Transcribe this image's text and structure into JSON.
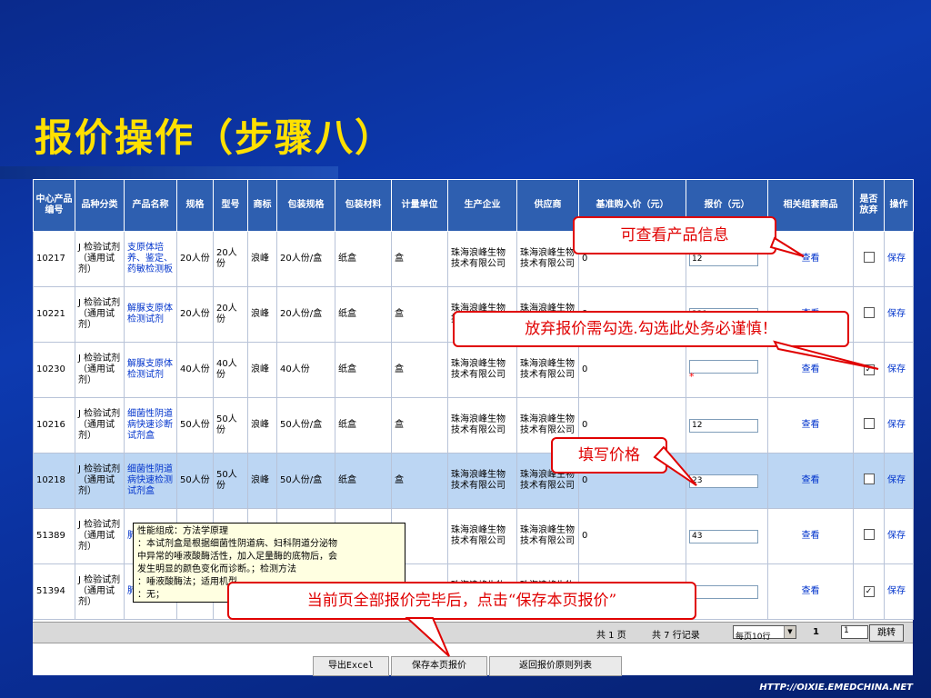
{
  "slide": {
    "title": "报价操作（步骤八）",
    "footer_url": "HTTP://OIXIE.EMEDCHINA.NET"
  },
  "table": {
    "headers": [
      "中心产品编号",
      "品种分类",
      "产品名称",
      "规格",
      "型号",
      "商标",
      "包装规格",
      "包装材料",
      "计量单位",
      "生产企业",
      "供应商",
      "基准购入价（元）",
      "报价（元）",
      "相关组套商品",
      "是否放弃",
      "操作"
    ],
    "rows": [
      {
        "id": "10217",
        "category": "J 检验试剂（通用试剂）",
        "name": "支原体培养、鉴定、药敏检测板",
        "spec": "20人份",
        "model": "20人份",
        "brand": "浪峰",
        "pack_spec": "20人份/盒",
        "pack_material": "纸盒",
        "unit": "盒",
        "maker": "珠海浪峰生物技术有限公司",
        "supplier": "珠海浪峰生物技术有限公司",
        "base_price": "0",
        "quote": "12",
        "view": "查看",
        "abandon": false,
        "action": "保存",
        "highlight": false,
        "required": false
      },
      {
        "id": "10221",
        "category": "J 检验试剂（通用试剂）",
        "name": "解脲支原体检测试剂",
        "spec": "20人份",
        "model": "20人份",
        "brand": "浪峰",
        "pack_spec": "20人份/盒",
        "pack_material": "纸盒",
        "unit": "盒",
        "maker": "珠海浪峰生物技术有限公司",
        "supplier": "珠海浪峰生物技术有限公司",
        "base_price": "0",
        "quote": "321",
        "view": "查看",
        "abandon": false,
        "action": "保存",
        "highlight": false,
        "required": false
      },
      {
        "id": "10230",
        "category": "J 检验试剂（通用试剂）",
        "name": "解脲支原体检测试剂",
        "spec": "40人份",
        "model": "40人份",
        "brand": "浪峰",
        "pack_spec": "40人份",
        "pack_material": "纸盒",
        "unit": "盒",
        "maker": "珠海浪峰生物技术有限公司",
        "supplier": "珠海浪峰生物技术有限公司",
        "base_price": "0",
        "quote": "",
        "view": "查看",
        "abandon": true,
        "action": "保存",
        "highlight": false,
        "required": true
      },
      {
        "id": "10216",
        "category": "J 检验试剂（通用试剂）",
        "name": "细菌性阴道病快速诊断试剂盒",
        "spec": "50人份",
        "model": "50人份",
        "brand": "浪峰",
        "pack_spec": "50人份/盒",
        "pack_material": "纸盒",
        "unit": "盒",
        "maker": "珠海浪峰生物技术有限公司",
        "supplier": "珠海浪峰生物技术有限公司",
        "base_price": "0",
        "quote": "12",
        "view": "查看",
        "abandon": false,
        "action": "保存",
        "highlight": false,
        "required": false
      },
      {
        "id": "10218",
        "category": "J 检验试剂（通用试剂）",
        "name": "细菌性阴道病快速检测试剂盒",
        "spec": "50人份",
        "model": "50人份",
        "brand": "浪峰",
        "pack_spec": "50人份/盒",
        "pack_material": "纸盒",
        "unit": "盒",
        "maker": "珠海浪峰生物技术有限公司",
        "supplier": "珠海浪峰生物技术有限公司",
        "base_price": "0",
        "quote": "23",
        "view": "查看",
        "abandon": false,
        "action": "保存",
        "highlight": true,
        "required": false
      },
      {
        "id": "51389",
        "category": "J 检验试剂（通用试剂）",
        "name": "肺…",
        "spec": "",
        "model": "",
        "brand": "",
        "pack_spec": "",
        "pack_material": "",
        "unit": "份",
        "maker": "珠海浪峰生物技术有限公司",
        "supplier": "珠海浪峰生物技术有限公司",
        "base_price": "0",
        "quote": "43",
        "view": "查看",
        "abandon": false,
        "action": "保存",
        "highlight": false,
        "required": false
      },
      {
        "id": "51394",
        "category": "J 检验试剂（通用试剂）",
        "name": "肺…",
        "spec": "",
        "model": "",
        "brand": "",
        "pack_spec": "",
        "pack_material": "",
        "unit": "",
        "maker": "珠海浪峰生物技术有限公司",
        "supplier": "珠海浪峰生物技术有限公司",
        "base_price": "0",
        "quote": "",
        "view": "查看",
        "abandon": true,
        "action": "保存",
        "highlight": false,
        "required": false
      }
    ]
  },
  "pager": {
    "pages": "共 1 页",
    "records": "共 7 行记录",
    "per_page": "每页10行",
    "current": "1",
    "page_input": "1",
    "jump": "跳转"
  },
  "buttons": {
    "export": "导出Excel",
    "save_page": "保存本页报价",
    "back": "返回报价原则列表"
  },
  "tooltip": {
    "lines": [
      "性能组成：方法学原理",
      "：本试剂盒是根据细菌性阴道病、妇科阴道分泌物",
      "中异常的唾液酸酶活性，加入足量酶的底物后，会",
      "发生明显的颜色变化而诊断。；检测方法",
      "：唾液酸酶法；适用机型",
      "：无；"
    ]
  },
  "callouts": {
    "view_info": "可查看产品信息",
    "abandon_warning": "放弃报价需勾选.勾选此处务必谨慎！",
    "fill_price": "填写价格",
    "save_hint": "当前页全部报价完毕后，点击“保存本页报价”"
  },
  "colors": {
    "header_bg": "#2e5fb0",
    "highlight_row": "#bcd6f3",
    "title": "#ffe000",
    "callout": "#e00000"
  }
}
